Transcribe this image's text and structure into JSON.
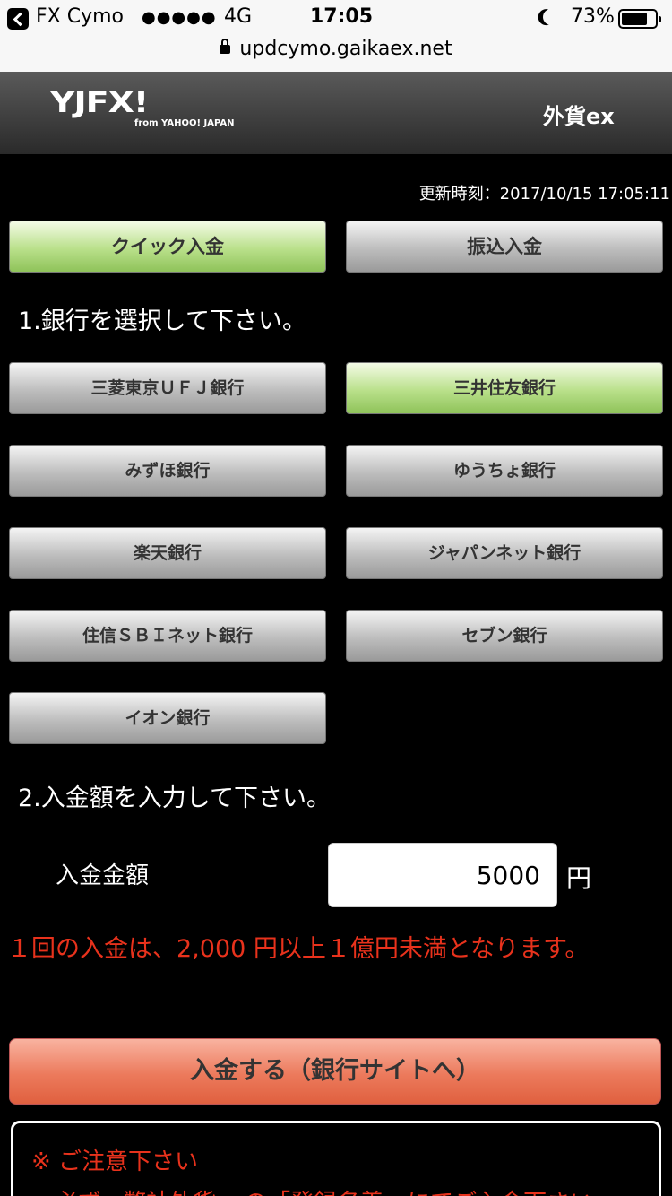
{
  "status_bar": {
    "app_name": "FX Cymo",
    "signal": "●●●●●",
    "network": "4G",
    "time": "17:05",
    "battery": "73%",
    "url": "updcymo.gaikaex.net"
  },
  "header": {
    "logo": "YJFX!",
    "logo_sub": "from YAHOO! JAPAN",
    "brand_right": "外貨ex"
  },
  "timestamp": "更新時刻：2017/10/15 17:05:11",
  "tabs": [
    {
      "label": "クイック入金",
      "active": true
    },
    {
      "label": "振込入金",
      "active": false
    }
  ],
  "step1_title": "1.銀行を選択して下さい。",
  "banks": [
    {
      "label": "三菱東京ＵＦＪ銀行",
      "selected": false
    },
    {
      "label": "三井住友銀行",
      "selected": true
    },
    {
      "label": "みずほ銀行",
      "selected": false
    },
    {
      "label": "ゆうちょ銀行",
      "selected": false
    },
    {
      "label": "楽天銀行",
      "selected": false
    },
    {
      "label": "ジャパンネット銀行",
      "selected": false
    },
    {
      "label": "住信ＳＢＩネット銀行",
      "selected": false
    },
    {
      "label": "セブン銀行",
      "selected": false
    },
    {
      "label": "イオン銀行",
      "selected": false
    }
  ],
  "step2_title": "2.入金額を入力して下さい。",
  "amount": {
    "label": "入金金額",
    "value": "5000",
    "unit": "円"
  },
  "notice": "１回の入金は、2,000 円以上１億円未満となります。",
  "submit_label": "入金する（銀行サイトへ）",
  "caution": {
    "title": "※ ご注意下さい",
    "text": "・必ず、弊社外貨exの「登録名義」にてご入金下さい。"
  }
}
